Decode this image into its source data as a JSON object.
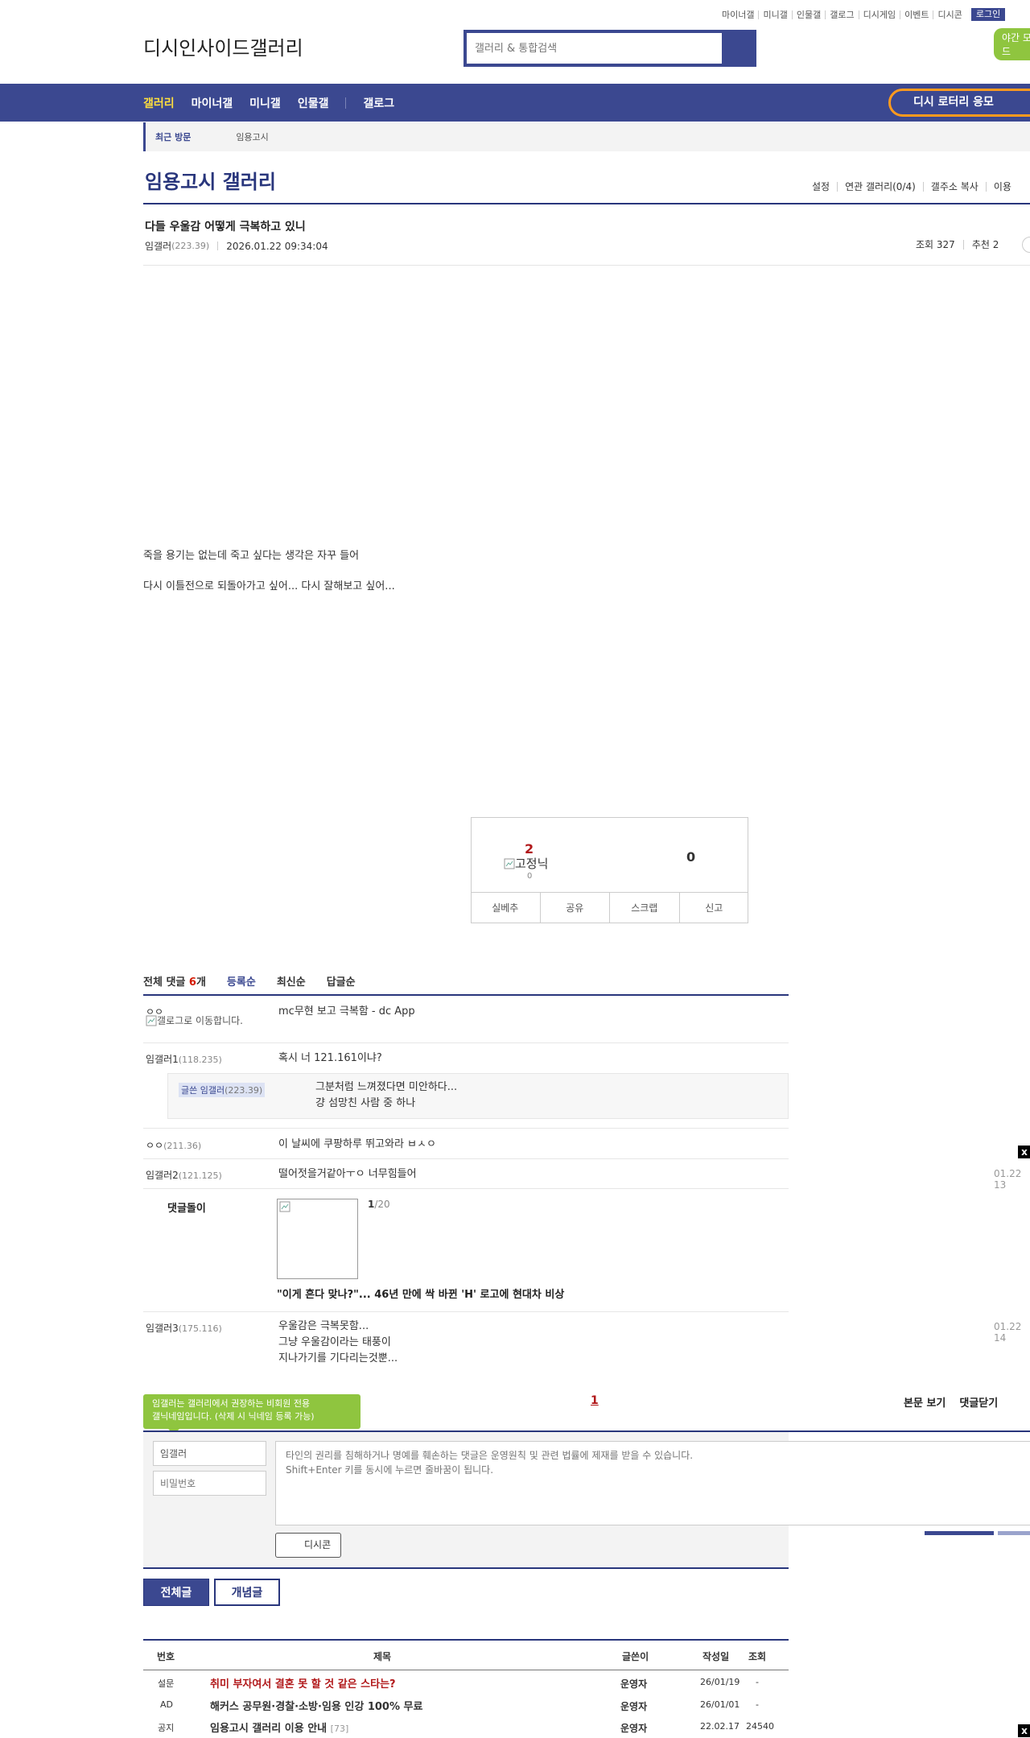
{
  "header": {
    "util_links": [
      "마이너갤",
      "미니갤",
      "인물갤",
      "갤로그",
      "디시게임",
      "이벤트",
      "디시콘"
    ],
    "login_label": "로그인",
    "night_mode_label": "야간 모드",
    "logo_alt": "디시인사이드갤러리",
    "search_placeholder": "갤러리 & 통합검색"
  },
  "nav": {
    "items": [
      "갤러리",
      "마이너갤",
      "미니갤",
      "인물갤",
      "갤로그"
    ],
    "lottery_label": "디시 로터리 응모"
  },
  "recent": {
    "label": "최근 방문",
    "gallery": "임용고시"
  },
  "gallery": {
    "title": "임용고시 갤러리",
    "menu": [
      "설정",
      "연관 갤러리(0/4)",
      "갤주소 복사",
      "이용"
    ]
  },
  "post": {
    "title": "다들 우울감 어떻게 극복하고 있니",
    "author": "임갤러",
    "author_ip": "(223.39)",
    "datetime": "2026.01.22 09:34:04",
    "views": "조회 327",
    "recommend": "추천 2",
    "body": [
      "죽을 용기는 없는데 죽고 싶다는 생각은 자꾸 들어",
      "다시 이틀전으로 되돌아가고 싶어... 다시 잘해보고 싶어..."
    ]
  },
  "vote": {
    "up_count": "2",
    "fixed_nick_alt": "고정닉",
    "fixed_count": "0",
    "down_count": "0",
    "buttons": [
      "실베추",
      "공유",
      "스크랩",
      "신고"
    ]
  },
  "comments": {
    "tabs": {
      "total_prefix": "전체 댓글 ",
      "total_count": "6",
      "total_suffix": "개",
      "sort": [
        "등록순",
        "최신순",
        "답글순"
      ]
    },
    "list": [
      {
        "name": "ㅇㅇ",
        "name_img_alt": "갤로그로 이동합니다.",
        "text": "mc무현 보고 극복함 - dc App"
      },
      {
        "name": "임갤러1",
        "ip": "(118.235)",
        "text": "혹시 너 121.161이냐?"
      },
      {
        "reply_name": "글쓴 임갤러",
        "reply_ip": "(223.39)",
        "reply_lines": [
          "그분처럼 느껴졌다면 미안하다...",
          "걍 섬망친 사람 중 하나"
        ]
      },
      {
        "name": "ㅇㅇ",
        "ip": "(211.36)",
        "text": "이 날씨에 쿠팡하루 뛰고와라 ㅂㅅㅇ"
      },
      {
        "name": "임갤러2",
        "ip": "(121.125)",
        "text": "떨어젓을거같아ㅜㅇ 너무힘들어",
        "date": "01.22 13"
      },
      {
        "name": "임갤러3",
        "ip": "(175.116)",
        "lines": [
          "우울감은 극복못함...",
          "그냥 우울감이라는 태풍이",
          "지나가기를 기다리는것뿐..."
        ],
        "date": "01.22 14"
      }
    ],
    "dg": {
      "label": "댓글돌이",
      "page_cur": "1",
      "page_total": "/20",
      "news": "\"이게 흔다 맞나?\"... 46년 만에 싹 바뀐 'H' 로고에 현대차 비상"
    },
    "close_x": "x"
  },
  "write": {
    "tooltip": [
      "임갤러는 갤러리에서 권장하는 비회원 전용",
      "갤닉네임입니다. (삭제 시 닉네임 등록 가능)"
    ],
    "page": "1",
    "body_view": "본문 보기",
    "close_comments": "댓글닫기",
    "nick_value": "임갤러",
    "password_placeholder": "비밀번호",
    "textarea_placeholder": "타인의 권리를 침해하거나 명예를 훼손하는 댓글은 운영원칙 및 관련 법률에 제재를 받을 수 있습니다.\nShift+Enter 키를 동시에 누르면 줄바꿈이 됩니다.",
    "dccon_label": "디시콘"
  },
  "list_tabs": [
    "전체글",
    "개념글"
  ],
  "post_list": {
    "headers": [
      "번호",
      "제목",
      "글쓴이",
      "작성일",
      "조회"
    ],
    "rows": [
      {
        "num": "설문",
        "title": "취미 부자여서 결혼 못 할 것 같은 스타는?",
        "author": "운영자",
        "date": "26/01/19",
        "views": "-",
        "red": true
      },
      {
        "num": "AD",
        "title": "해커스 공무원·경찰·소방·임용 인강 100% 무료",
        "author": "운영자",
        "date": "26/01/01",
        "views": "-"
      },
      {
        "num": "공지",
        "title": "임용고시 갤러리 이용 안내",
        "count": "[73]",
        "author": "운영자",
        "date": "22.02.17",
        "views": "24540"
      }
    ]
  },
  "colors": {
    "brand": "#3b4890",
    "brand_dark": "#29367c",
    "accent_yellow": "#ffdf3e",
    "lottery_orange": "#ff9a1e",
    "night_green": "#8fc53f",
    "red": "#b1181a"
  }
}
